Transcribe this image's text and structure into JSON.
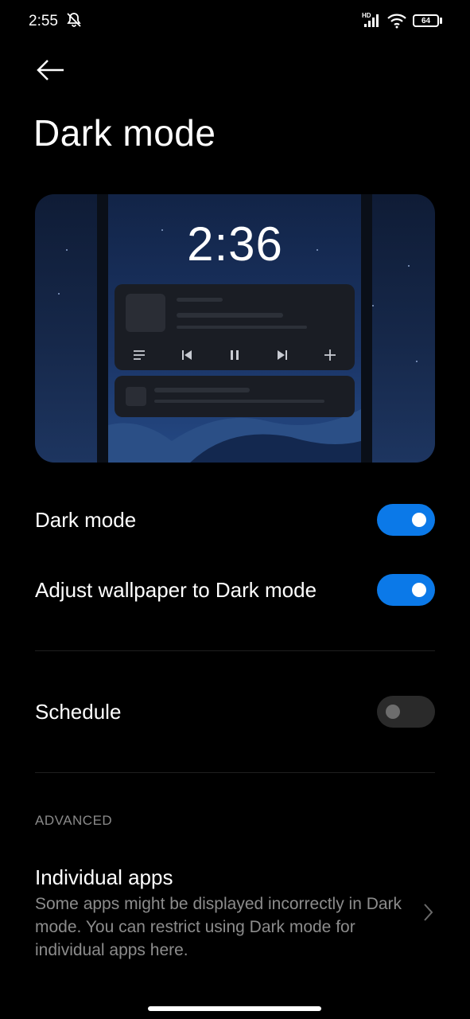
{
  "status_bar": {
    "time": "2:55",
    "battery": "64",
    "network_badge": "HD",
    "icons": [
      "bell-off-icon",
      "signal-icon",
      "wifi-icon",
      "battery-icon"
    ]
  },
  "header": {
    "back_icon": "arrow-left-icon",
    "title": "Dark mode"
  },
  "preview": {
    "clock": "2:36",
    "media_controls": [
      "playlist-icon",
      "previous-icon",
      "pause-icon",
      "next-icon",
      "plus-icon"
    ]
  },
  "settings": {
    "dark_mode": {
      "label": "Dark mode",
      "enabled": true
    },
    "adjust_wallpaper": {
      "label": "Adjust wallpaper to Dark mode",
      "enabled": true
    },
    "schedule": {
      "label": "Schedule",
      "enabled": false
    }
  },
  "advanced": {
    "section_label": "ADVANCED",
    "individual_apps": {
      "title": "Individual apps",
      "description": "Some apps might be displayed incorrectly in Dark mode. You can restrict using Dark mode for individual apps here.",
      "chevron_icon": "chevron-right-icon"
    }
  },
  "colors": {
    "accent": "#0b79e8",
    "background": "#000000",
    "toggle_off": "#2a2a2a"
  }
}
